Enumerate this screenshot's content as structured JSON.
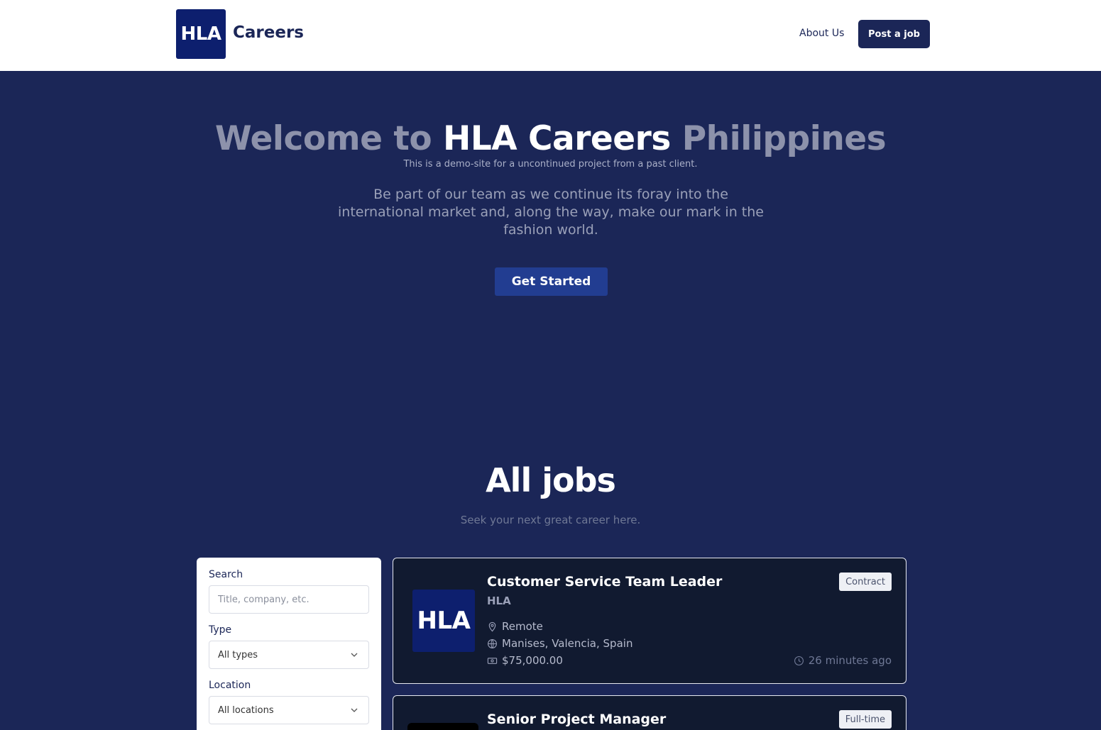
{
  "header": {
    "logo_text": "HLA",
    "brand": "Careers",
    "nav_about": "About Us",
    "nav_post": "Post a job"
  },
  "hero": {
    "title_part1": "Welcome to ",
    "title_part2": "HLA Careers",
    "title_part3": " Philippines",
    "note": "This is a demo-site for a uncontinued project from a past client.",
    "subtitle": "Be part of our team as we continue its foray into the international market and, along the way, make our mark in the fashion world.",
    "cta": "Get Started"
  },
  "jobs": {
    "title": "All jobs",
    "subtitle": "Seek your next great career here."
  },
  "filters": {
    "search_label": "Search",
    "search_placeholder": "Title, company, etc.",
    "type_label": "Type",
    "type_value": "All types",
    "location_label": "Location",
    "location_value": "All locations"
  },
  "listings": [
    {
      "logo_text": "HLA",
      "title": "Customer Service Team Leader",
      "company": "HLA",
      "work_mode": "Remote",
      "location": "Manises, Valencia, Spain",
      "salary": "$75,000.00",
      "type": "Contract",
      "posted": "26 minutes ago"
    },
    {
      "title": "Senior Project Manager",
      "type": "Full-time"
    }
  ],
  "colors": {
    "page_bg": "#1b2657",
    "header_bg": "#ffffff",
    "brand_navy": "#0d1f6e",
    "cta_bg": "#223d91",
    "card_bg": "#111a30"
  },
  "icons": {
    "location": "map-pin-icon",
    "globe": "globe-icon",
    "salary": "banknote-icon",
    "clock": "clock-icon",
    "chevron": "chevron-down-icon"
  }
}
